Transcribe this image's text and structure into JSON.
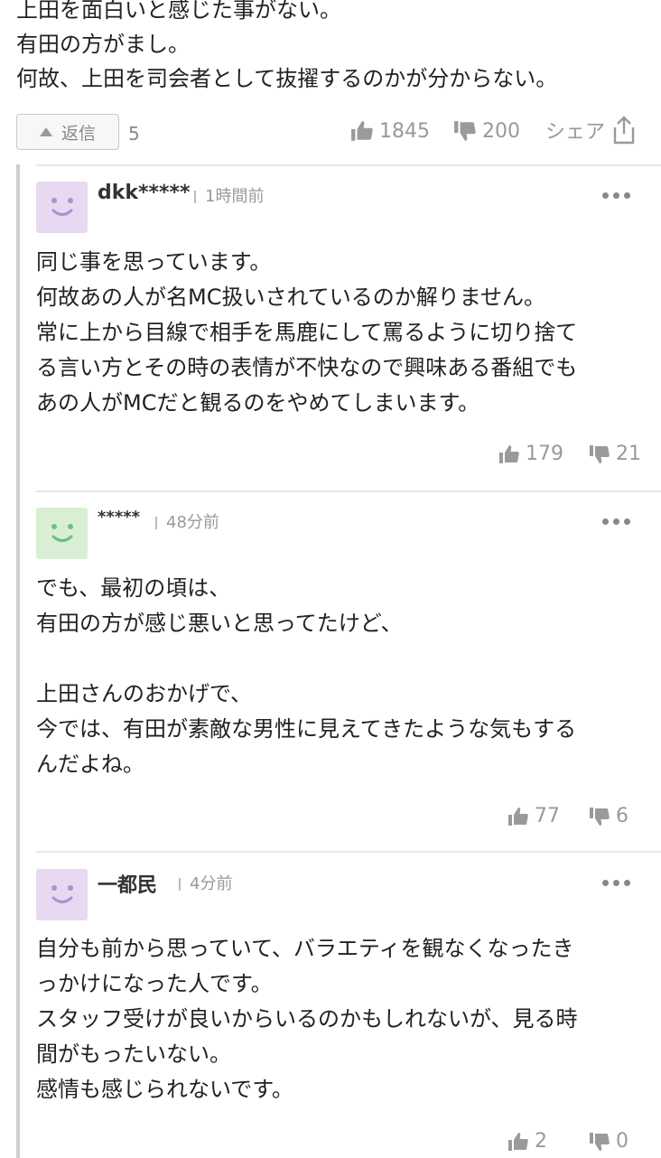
{
  "parent_comment": {
    "lines": [
      "上田を面白いと感じた事がない。",
      "有田の方がまし。",
      "何故、上田を司会者として抜擢するのかが分からない。"
    ],
    "reply_label": "返信",
    "reply_count": "5",
    "likes": "1845",
    "dislikes": "200",
    "share_label": "シェア"
  },
  "replies": [
    {
      "username": "dkk*****",
      "time": "1時間前",
      "avatar_color": "#e6d9f1",
      "avatar_face_color": "#b48ccf",
      "lines": [
        "同じ事を思っています。",
        "何故あの人が名MC扱いされているのか解りません。",
        "常に上から目線で相手を馬鹿にして罵るように切り捨て",
        "る言い方とその時の表情が不快なので興味ある番組でも",
        "あの人がMCだと観るのをやめてしまいます。"
      ],
      "likes": "179",
      "dislikes": "21"
    },
    {
      "username": "*****",
      "time": "48分前",
      "avatar_color": "#d9efd3",
      "avatar_face_color": "#6bbd8a",
      "lines": [
        "でも、最初の頃は、",
        "有田の方が感じ悪いと思ってたけど、",
        "",
        "上田さんのおかげで、",
        "今では、有田が素敵な男性に見えてきたような気もする",
        "んだよね。"
      ],
      "likes": "77",
      "dislikes": "6"
    },
    {
      "username": "一都民",
      "time": "4分前",
      "avatar_color": "#e6d9f1",
      "avatar_face_color": "#b48ccf",
      "lines": [
        "自分も前から思っていて、バラエティを観なくなったき",
        "っかけになった人です。",
        "スタッフ受けが良いからいるのかもしれないが、見る時",
        "間がもったいない。",
        "感情も感じられないです。"
      ],
      "likes": "2",
      "dislikes": "0"
    }
  ]
}
